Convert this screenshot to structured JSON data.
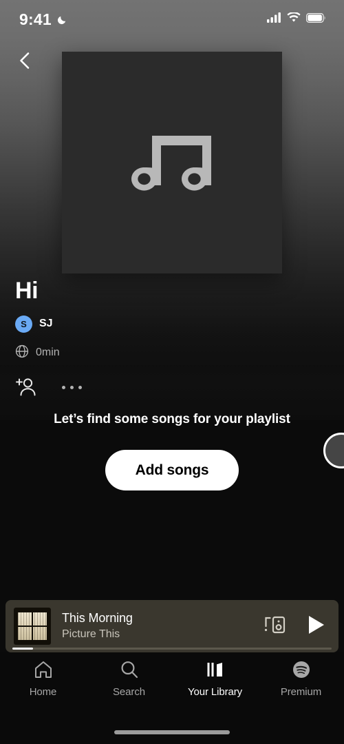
{
  "status_bar": {
    "time": "9:41",
    "dnd_icon": "crescent-moon-icon",
    "signal_icon": "cellular-signal-icon",
    "wifi_icon": "wifi-icon",
    "battery_icon": "battery-icon"
  },
  "header": {
    "back_icon": "chevron-left-icon",
    "cover_placeholder_icon": "music-note-icon"
  },
  "playlist": {
    "title": "Hi",
    "owner": {
      "avatar_initial": "S",
      "avatar_color": "#6aaaf5",
      "name": "SJ"
    },
    "visibility_icon": "globe-icon",
    "duration": "0min",
    "add_people_icon": "add-person-icon",
    "more_options_icon": "more-horizontal-icon"
  },
  "empty_state": {
    "message": "Let’s find some songs for your playlist",
    "add_songs_label": "Add songs"
  },
  "cursor": {
    "shape": "circle-pointer"
  },
  "now_playing": {
    "title": "This Morning",
    "artist": "Picture This",
    "artwork_name": "album-art-this-morning",
    "connect_icon": "spotify-connect-icon",
    "play_icon": "play-icon",
    "progress_percent": 6.5,
    "background_color": "#3a372e"
  },
  "tabbar": {
    "items": [
      {
        "label": "Home",
        "icon": "home-icon",
        "active": false
      },
      {
        "label": "Search",
        "icon": "search-icon",
        "active": false
      },
      {
        "label": "Your Library",
        "icon": "library-icon",
        "active": true
      },
      {
        "label": "Premium",
        "icon": "spotify-logo-icon",
        "active": false
      }
    ]
  }
}
